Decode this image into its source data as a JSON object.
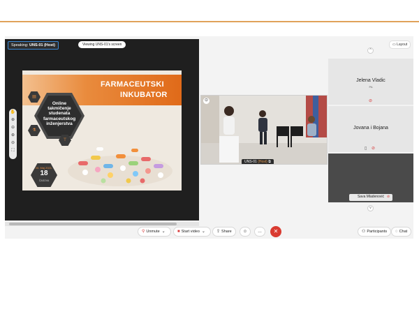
{
  "colors": {
    "accent_rule": "#e0a25a",
    "end_call": "#d93b31",
    "slide_orange": "#e06a19",
    "muted_red": "#d83b3b"
  },
  "share": {
    "speaking_label": "Speaking:",
    "speaking_name": "UNS-01 (Host)",
    "viewing_text": "Viewing UNS-01's screen",
    "zoom_tools": [
      "hand-icon",
      "zoom-in-icon",
      "zoom-out-icon",
      "fit-icon"
    ]
  },
  "slide": {
    "title_line1": "FARMACEUTSKI",
    "title_line2": "INKUBATOR",
    "hex_text": "Online takmičenje studenata farmaceutskog inženjerstva",
    "date_small": "26. Maj 2021.",
    "date_big": "18",
    "date_sub": "ČASOVA"
  },
  "main_video": {
    "name": "UNS-01",
    "role": "(Host)"
  },
  "layout_button": "Layout",
  "participants": [
    {
      "name": "Jelena Vladic",
      "sub": "PA"
    },
    {
      "name": "Jovana i Bojana",
      "sub": ""
    },
    {
      "name": "Sava Mladenović",
      "sub": ""
    }
  ],
  "controls": {
    "unmute": "Unmute",
    "start_video": "Start video",
    "share": "Share",
    "participants": "Participants",
    "chat": "Chat"
  }
}
